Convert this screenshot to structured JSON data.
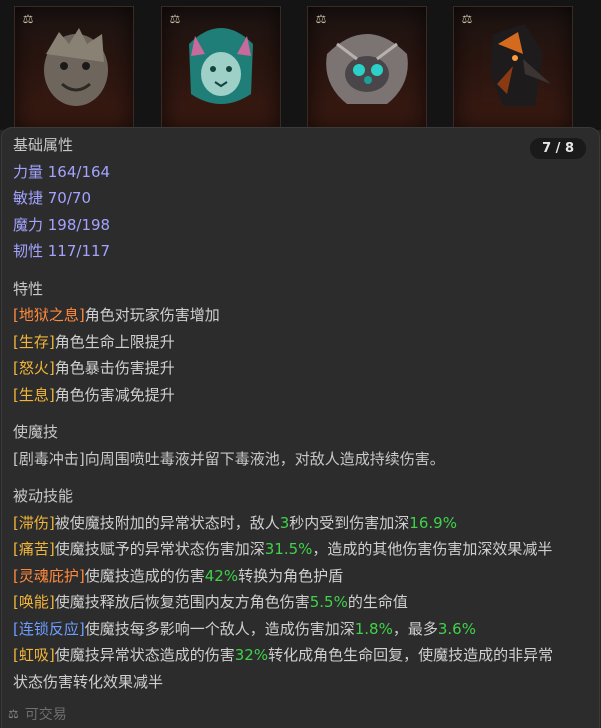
{
  "pager": {
    "label": "7 / 8"
  },
  "cards": [
    {
      "icon": "dragon-portrait-icon"
    },
    {
      "icon": "feline-spirit-portrait-icon"
    },
    {
      "icon": "spider-creature-portrait-icon"
    },
    {
      "icon": "shadow-bird-portrait-icon"
    }
  ],
  "card_badge": "⚖",
  "base_attributes": {
    "title": "基础属性",
    "stats": [
      "力量 164/164",
      "敏捷 70/70",
      "魔力 198/198",
      "韧性 117/117"
    ]
  },
  "traits": {
    "title": "特性",
    "items": [
      {
        "tag": "[地狱之息]",
        "text": "角色对玩家伤害增加"
      },
      {
        "tag": "[生存]",
        "text": "角色生命上限提升"
      },
      {
        "tag": "[怒火]",
        "text": "角色暴击伤害提升"
      },
      {
        "tag": "[生息]",
        "text": "角色伤害减免提升"
      }
    ]
  },
  "demon_skill": {
    "title": "使魔技",
    "text": "[剧毒冲击]向周围喷吐毒液并留下毒液池，对敌人造成持续伤害。"
  },
  "passive_skills": {
    "title": "被动技能",
    "items": [
      {
        "tag": "[滞伤]",
        "p1": "被使魔技附加的异常状态时，敌人",
        "n1": "3",
        "p2": "秒内受到伤害加深",
        "n2": "16.9%",
        "p3": ""
      },
      {
        "tag": "[痛苦]",
        "p1": "使魔技赋予的异常状态伤害加深",
        "n1": "31.5%",
        "p2": "，造成的其他伤害伤害加深效果减半",
        "n2": "",
        "p3": ""
      },
      {
        "tag": "[灵魂庇护]",
        "p1": "使魔技造成的伤害",
        "n1": "42%",
        "p2": "转换为角色护盾",
        "n2": "",
        "p3": ""
      },
      {
        "tag": "[唤能]",
        "p1": "使魔技释放后恢复范围内友方角色伤害",
        "n1": "5.5%",
        "p2": "的生命值",
        "n2": "",
        "p3": ""
      },
      {
        "tag": "[连锁反应]",
        "p1": "使魔技每多影响一个敌人，造成伤害加深",
        "n1": "1.8%",
        "p2": "，最多",
        "n2": "3.6%",
        "p3": ""
      },
      {
        "tag": "[虹吸]",
        "p1": "使魔技异常状态造成的伤害",
        "n1": "32%",
        "p2": "转化成角色生命回复，使魔技造成的非异常",
        "n2": "",
        "p3": ""
      }
    ],
    "last_line": "状态伤害转化效果减半"
  },
  "tradable": {
    "label": "可交易",
    "icon": "trade-scale-icon",
    "glyph": "⚖"
  },
  "colors": {
    "stat": "#a3a3ff",
    "tag_gold": "#f0b53a",
    "tag_orange": "#ff8a3d",
    "tag_blue": "#6d9dff",
    "number_green": "#3fd24a"
  }
}
